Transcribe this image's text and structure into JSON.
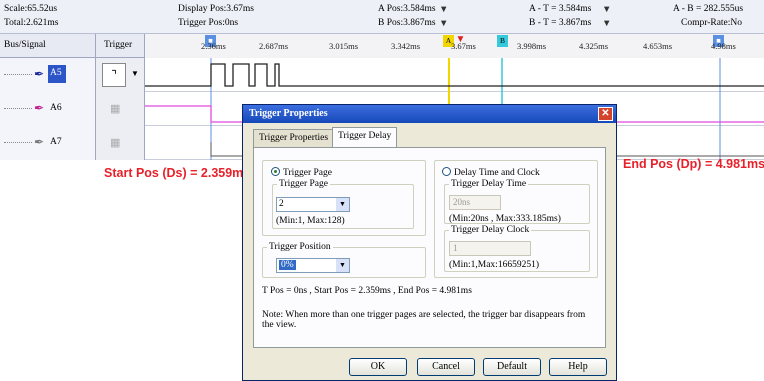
{
  "status": {
    "scale": "Scale:65.52us",
    "total": "Total:2.621ms",
    "display_pos": "Display Pos:3.67ms",
    "trigger_pos": "Trigger Pos:0ns",
    "a_pos": "A Pos:3.584ms",
    "b_pos": "B Pos:3.867ms",
    "a_t": "A - T = 3.584ms",
    "b_t": "B - T = 3.867ms",
    "a_b": "A - B = 282.555us",
    "compr": "Compr-Rate:No"
  },
  "header": {
    "bus_signal": "Bus/Signal",
    "trigger": "Trigger"
  },
  "ruler": {
    "ticks": [
      "2.36ms",
      "2.687ms",
      "3.015ms",
      "3.342ms",
      "3.67ms",
      "3.998ms",
      "4.325ms",
      "4.653ms",
      "4.98ms"
    ],
    "flag_a": "A",
    "flag_b": "B"
  },
  "signals": [
    {
      "name": "A5",
      "selected": true
    },
    {
      "name": "A6",
      "selected": false
    },
    {
      "name": "A7",
      "selected": false
    }
  ],
  "callouts": {
    "start": "Start Pos (Ds) = 2.359ms",
    "end": "End Pos (Dp) = 4.981ms"
  },
  "colors": {
    "callout_red": "#e8202a",
    "title_blue": "#1648b8",
    "cursor_a": "#f2d600",
    "cursor_b": "#35c9dc",
    "wave_a5": "#222222",
    "wave_a6": "#e04bdc"
  },
  "dialog": {
    "title": "Trigger Properties",
    "tabs": [
      "Trigger Properties",
      "Trigger Delay"
    ],
    "trigger_page_radio": "Trigger Page",
    "trigger_page_group": "Trigger Page",
    "trigger_page_value": "2",
    "trigger_page_range": "(Min:1, Max:128)",
    "trigger_position_group": "Trigger Position",
    "trigger_position_value": "0%",
    "delay_radio": "Delay Time and Clock",
    "delay_time_group": "Trigger Delay Time",
    "delay_time_value": "20ns",
    "delay_time_range": "(Min:20ns , Max:333.185ms)",
    "delay_clock_group": "Trigger Delay Clock",
    "delay_clock_value": "1",
    "delay_clock_range": "(Min:1,Max:16659251)",
    "summary": "T Pos = 0ns , Start Pos = 2.359ms , End Pos = 4.981ms",
    "note": "Note: When more than one trigger pages are selected, the trigger bar disappears from the view.",
    "buttons": {
      "ok": "OK",
      "cancel": "Cancel",
      "default": "Default",
      "help": "Help"
    }
  }
}
